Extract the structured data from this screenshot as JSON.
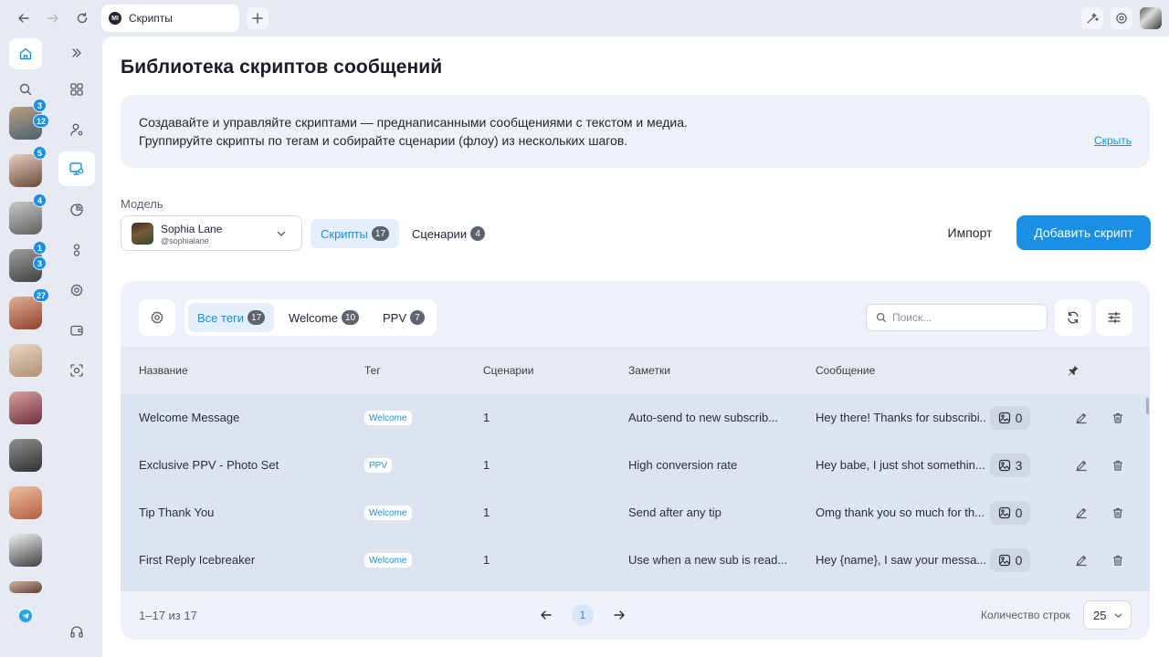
{
  "browser": {
    "tab_title": "Скрипты",
    "tab_logo": "MI"
  },
  "chats": [
    {
      "badges": [
        "3",
        "12"
      ],
      "colors": [
        "#b9a080",
        "#4a6070"
      ]
    },
    {
      "badges": [
        "5"
      ],
      "colors": [
        "#e8d0c0",
        "#6a4a3a"
      ]
    },
    {
      "badges": [
        "4"
      ],
      "colors": [
        "#c8c8c8",
        "#606060"
      ]
    },
    {
      "badges": [
        "1",
        "3"
      ],
      "colors": [
        "#a0a0a0",
        "#404040"
      ]
    },
    {
      "badges": [
        "27"
      ],
      "colors": [
        "#e0b090",
        "#904030"
      ]
    },
    {
      "badges": [],
      "colors": [
        "#e8d8c8",
        "#b09070"
      ]
    },
    {
      "badges": [],
      "colors": [
        "#d8a0a0",
        "#703040"
      ]
    },
    {
      "badges": [],
      "colors": [
        "#909090",
        "#303030"
      ]
    },
    {
      "badges": [],
      "colors": [
        "#f0c0a0",
        "#b06040"
      ]
    },
    {
      "badges": [],
      "colors": [
        "#f0f0f0",
        "#404040"
      ]
    }
  ],
  "page": {
    "title": "Библиотека скриптов сообщений",
    "info_line1": "Создавайте и управляйте скриптами — преднаписанными сообщениями с текстом и медиа.",
    "info_line2": "Группируйте скрипты по тегам и собирайте сценарии (флоу) из нескольких шагов.",
    "hide_link": "Скрыть"
  },
  "model": {
    "label": "Модель",
    "name": "Sophia Lane",
    "handle": "@sophialane"
  },
  "segments": {
    "scripts_label": "Скрипты",
    "scripts_count": "17",
    "scenarios_label": "Сценарии",
    "scenarios_count": "4"
  },
  "actions": {
    "import_label": "Импорт",
    "add_label": "Добавить скрипт"
  },
  "tags": [
    {
      "label": "Все теги",
      "count": "17"
    },
    {
      "label": "Welcome",
      "count": "10"
    },
    {
      "label": "PPV",
      "count": "7"
    }
  ],
  "search": {
    "placeholder": "Поиск..."
  },
  "table": {
    "headers": {
      "name": "Название",
      "tag": "Тег",
      "scenarios": "Сценарии",
      "notes": "Заметки",
      "message": "Сообщение"
    },
    "rows": [
      {
        "name": "Welcome Message",
        "tag": "Welcome",
        "scenarios": "1",
        "notes": "Auto-send to new subscrib...",
        "message": "Hey there! Thanks for subscribi...",
        "media": "0"
      },
      {
        "name": "Exclusive PPV - Photo Set",
        "tag": "PPV",
        "scenarios": "1",
        "notes": "High conversion rate",
        "message": "Hey babe, I just shot somethin...",
        "media": "3"
      },
      {
        "name": "Tip Thank You",
        "tag": "Welcome",
        "scenarios": "1",
        "notes": "Send after any tip",
        "message": "Omg thank you so much for th...",
        "media": "0"
      },
      {
        "name": "First Reply Icebreaker",
        "tag": "Welcome",
        "scenarios": "1",
        "notes": "Use when a new sub is read...",
        "message": "Hey {name}, I saw your messa...",
        "media": "0"
      }
    ]
  },
  "pagination": {
    "range": "1–17 из 17",
    "current_page": "1",
    "rows_label": "Количество строк",
    "rows_value": "25"
  }
}
